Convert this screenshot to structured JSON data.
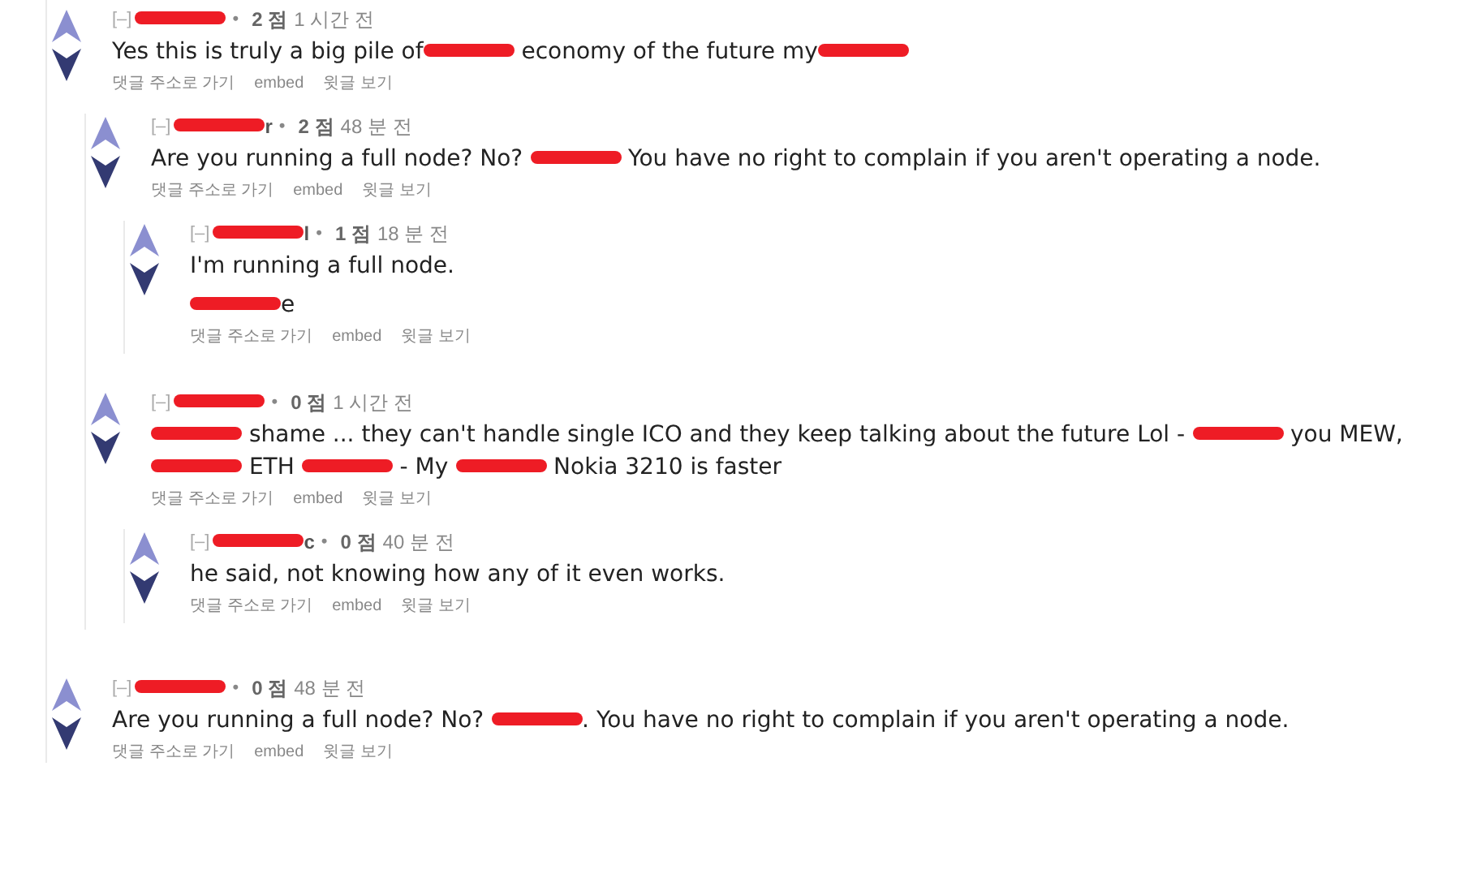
{
  "comments": [
    {
      "toggle": "[–]",
      "author": [
        {
          "kind": "redacted"
        }
      ],
      "separator": "•",
      "score": "2 점",
      "time": "1 시간 전",
      "paragraphs": [
        [
          {
            "kind": "text",
            "text": "Yes this is truly a big pile of"
          },
          {
            "kind": "redacted"
          },
          {
            "kind": "text",
            "text": " economy of the future my"
          },
          {
            "kind": "redacted"
          }
        ]
      ],
      "links": [
        "댓글 주소로 가기",
        "embed",
        "윗글 보기"
      ],
      "children": [
        {
          "toggle": "[–]",
          "author": [
            {
              "kind": "redacted"
            },
            {
              "kind": "text",
              "text": "r"
            }
          ],
          "separator": "•",
          "score": "2 점",
          "time": "48 분 전",
          "paragraphs": [
            [
              {
                "kind": "text",
                "text": "Are you running a full node? No? "
              },
              {
                "kind": "redacted"
              },
              {
                "kind": "text",
                "text": " You have no right to complain if you aren't operating a node."
              }
            ]
          ],
          "links": [
            "댓글 주소로 가기",
            "embed",
            "윗글 보기"
          ],
          "children": [
            {
              "toggle": "[–]",
              "author": [
                {
                  "kind": "redacted"
                },
                {
                  "kind": "text",
                  "text": "l"
                }
              ],
              "separator": "•",
              "score": "1 점",
              "time": "18 분 전",
              "paragraphs": [
                [
                  {
                    "kind": "text",
                    "text": "I'm running a full node."
                  }
                ],
                [
                  {
                    "kind": "redacted"
                  },
                  {
                    "kind": "text",
                    "text": "e"
                  }
                ]
              ],
              "links": [
                "댓글 주소로 가기",
                "embed",
                "윗글 보기"
              ]
            }
          ]
        },
        {
          "toggle": "[–]",
          "author": [
            {
              "kind": "redacted"
            }
          ],
          "separator": "•",
          "score": "0 점",
          "time": "1 시간 전",
          "paragraphs": [
            [
              {
                "kind": "redacted"
              },
              {
                "kind": "text",
                "text": " shame ... they can't handle single ICO and they keep talking about the future Lol - "
              },
              {
                "kind": "redacted"
              },
              {
                "kind": "text",
                "text": " you MEW, "
              },
              {
                "kind": "redacted"
              },
              {
                "kind": "text",
                "text": " ETH "
              },
              {
                "kind": "redacted"
              },
              {
                "kind": "text",
                "text": " - My "
              },
              {
                "kind": "redacted"
              },
              {
                "kind": "text",
                "text": " Nokia 3210 is faster"
              }
            ]
          ],
          "links": [
            "댓글 주소로 가기",
            "embed",
            "윗글 보기"
          ],
          "children": [
            {
              "toggle": "[–]",
              "author": [
                {
                  "kind": "redacted"
                },
                {
                  "kind": "text",
                  "text": "c"
                }
              ],
              "separator": "•",
              "score": "0 점",
              "time": "40 분 전",
              "paragraphs": [
                [
                  {
                    "kind": "text",
                    "text": "he said, not knowing how any of it even works."
                  }
                ]
              ],
              "links": [
                "댓글 주소로 가기",
                "embed",
                "윗글 보기"
              ]
            }
          ]
        }
      ]
    },
    {
      "toggle": "[–]",
      "author": [
        {
          "kind": "redacted"
        }
      ],
      "separator": "•",
      "score": "0 점",
      "time": "48 분 전",
      "paragraphs": [
        [
          {
            "kind": "text",
            "text": "Are you running a full node? No? "
          },
          {
            "kind": "redacted"
          },
          {
            "kind": "text",
            "text": ". You have no right to complain if you aren't operating a node."
          }
        ]
      ],
      "links": [
        "댓글 주소로 가기",
        "embed",
        "윗글 보기"
      ]
    }
  ]
}
